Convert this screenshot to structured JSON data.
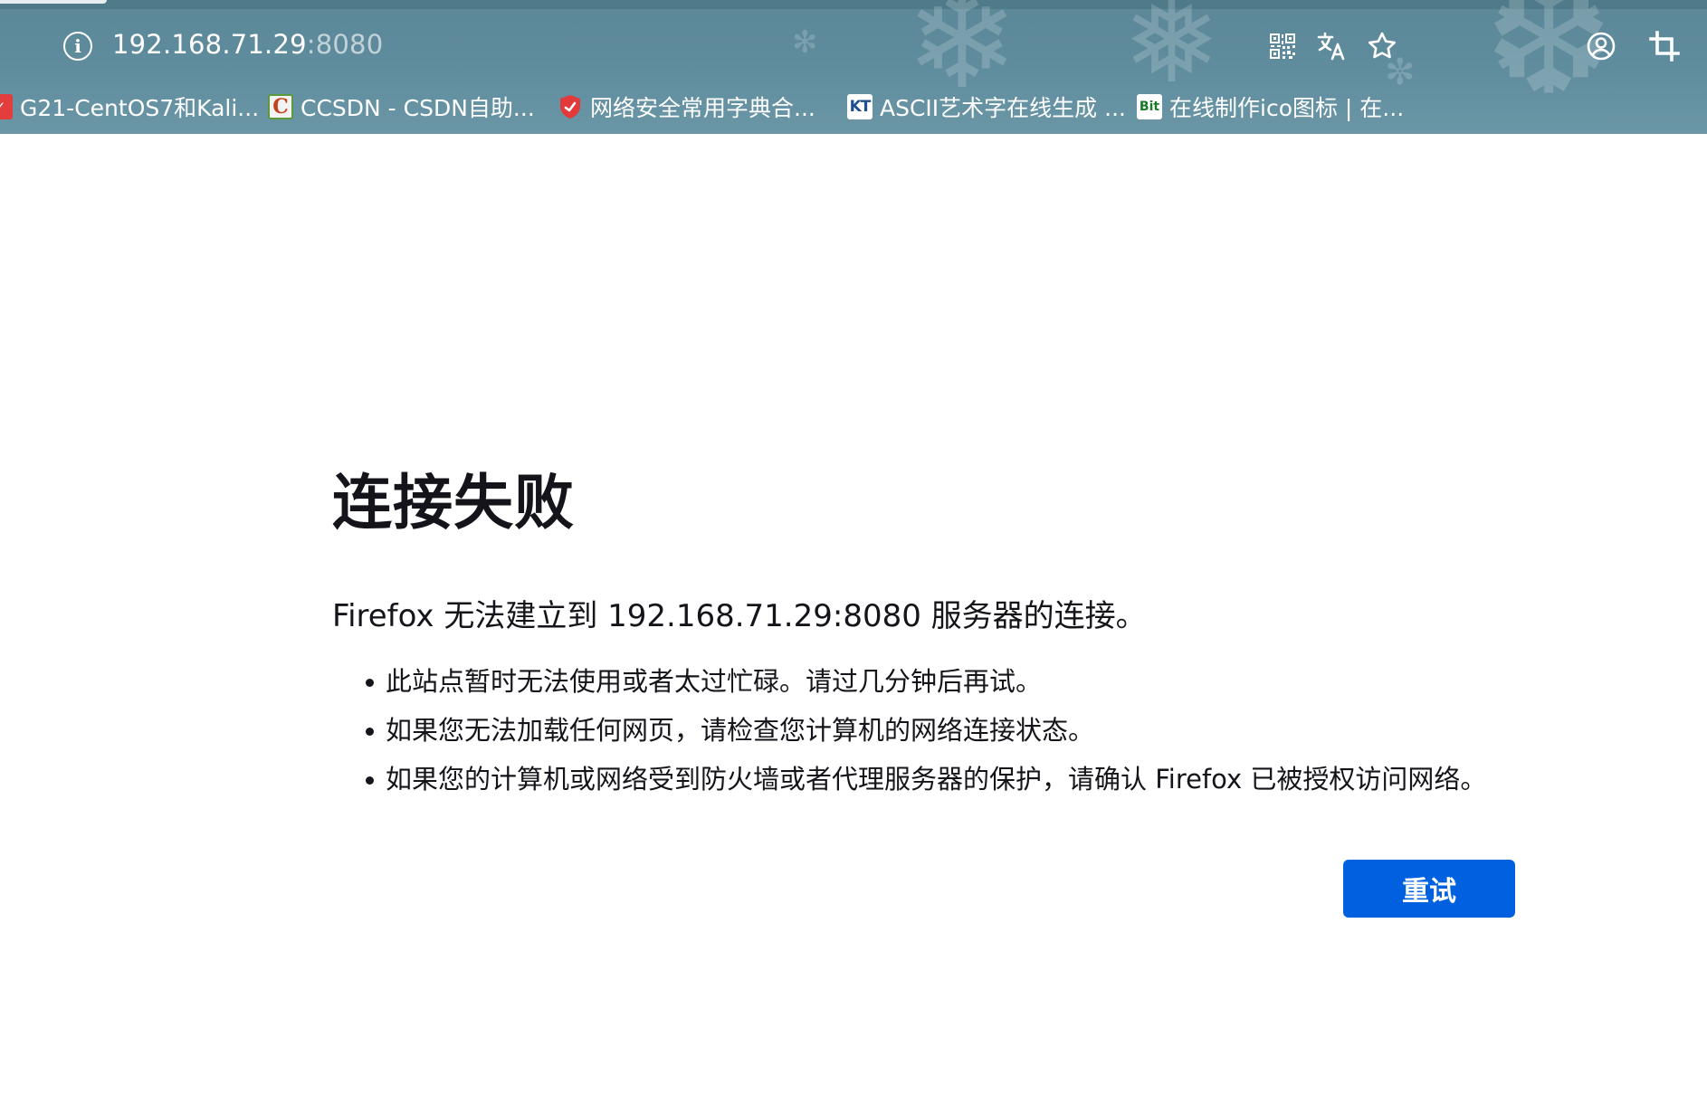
{
  "browser": {
    "url_host": "192.168.71.29",
    "url_port": ":8080",
    "icons": {
      "site_info": "info-icon",
      "qr_code": "qr-code-icon",
      "translate": "translate-icon",
      "bookmark": "star-icon",
      "account": "account-icon",
      "screenshot": "crop-icon"
    },
    "bookmarks": [
      {
        "label": "G21-CentOS7和Kali...",
        "icon": "red-circle-favicon"
      },
      {
        "label": "CCSDN - CSDN自助...",
        "icon": "c-favicon"
      },
      {
        "label": "网络安全常用字典合...",
        "icon": "red-shield-favicon"
      },
      {
        "label": "ASCII艺术字在线生成 ...",
        "icon": "kt-favicon",
        "icon_text": "KT"
      },
      {
        "label": "在线制作ico图标 | 在...",
        "icon": "bit-favicon",
        "icon_text": "Bit"
      }
    ],
    "theme_color": "#5f8c9d"
  },
  "error_page": {
    "title": "连接失败",
    "description": "Firefox 无法建立到 192.168.71.29:8080 服务器的连接。",
    "suggestions": [
      "此站点暂时无法使用或者太过忙碌。请过几分钟后再试。",
      "如果您无法加载任何网页，请检查您计算机的网络连接状态。",
      "如果您的计算机或网络受到防火墙或者代理服务器的保护，请确认 Firefox 已被授权访问网络。"
    ],
    "retry_label": "重试",
    "accent_color": "#0061e0"
  }
}
